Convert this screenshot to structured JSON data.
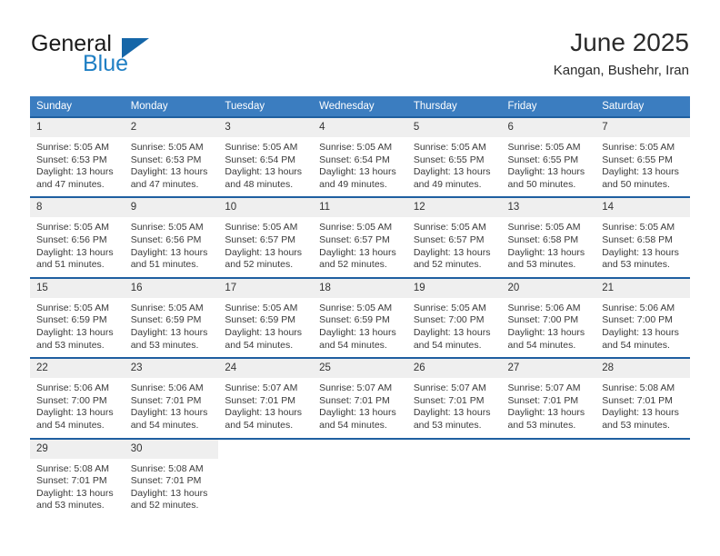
{
  "brand": {
    "name_part1": "General",
    "name_part2": "Blue",
    "accent_color": "#1f7fc4",
    "triangle_color": "#1566a8"
  },
  "header": {
    "title": "June 2025",
    "subtitle": "Kangan, Bushehr, Iran"
  },
  "calendar": {
    "header_bg": "#3b7dc0",
    "weekday_headers": [
      "Sunday",
      "Monday",
      "Tuesday",
      "Wednesday",
      "Thursday",
      "Friday",
      "Saturday"
    ],
    "weeks": [
      [
        {
          "day": "1",
          "sunrise": "Sunrise: 5:05 AM",
          "sunset": "Sunset: 6:53 PM",
          "daylight_line1": "Daylight: 13 hours",
          "daylight_line2": "and 47 minutes."
        },
        {
          "day": "2",
          "sunrise": "Sunrise: 5:05 AM",
          "sunset": "Sunset: 6:53 PM",
          "daylight_line1": "Daylight: 13 hours",
          "daylight_line2": "and 47 minutes."
        },
        {
          "day": "3",
          "sunrise": "Sunrise: 5:05 AM",
          "sunset": "Sunset: 6:54 PM",
          "daylight_line1": "Daylight: 13 hours",
          "daylight_line2": "and 48 minutes."
        },
        {
          "day": "4",
          "sunrise": "Sunrise: 5:05 AM",
          "sunset": "Sunset: 6:54 PM",
          "daylight_line1": "Daylight: 13 hours",
          "daylight_line2": "and 49 minutes."
        },
        {
          "day": "5",
          "sunrise": "Sunrise: 5:05 AM",
          "sunset": "Sunset: 6:55 PM",
          "daylight_line1": "Daylight: 13 hours",
          "daylight_line2": "and 49 minutes."
        },
        {
          "day": "6",
          "sunrise": "Sunrise: 5:05 AM",
          "sunset": "Sunset: 6:55 PM",
          "daylight_line1": "Daylight: 13 hours",
          "daylight_line2": "and 50 minutes."
        },
        {
          "day": "7",
          "sunrise": "Sunrise: 5:05 AM",
          "sunset": "Sunset: 6:55 PM",
          "daylight_line1": "Daylight: 13 hours",
          "daylight_line2": "and 50 minutes."
        }
      ],
      [
        {
          "day": "8",
          "sunrise": "Sunrise: 5:05 AM",
          "sunset": "Sunset: 6:56 PM",
          "daylight_line1": "Daylight: 13 hours",
          "daylight_line2": "and 51 minutes."
        },
        {
          "day": "9",
          "sunrise": "Sunrise: 5:05 AM",
          "sunset": "Sunset: 6:56 PM",
          "daylight_line1": "Daylight: 13 hours",
          "daylight_line2": "and 51 minutes."
        },
        {
          "day": "10",
          "sunrise": "Sunrise: 5:05 AM",
          "sunset": "Sunset: 6:57 PM",
          "daylight_line1": "Daylight: 13 hours",
          "daylight_line2": "and 52 minutes."
        },
        {
          "day": "11",
          "sunrise": "Sunrise: 5:05 AM",
          "sunset": "Sunset: 6:57 PM",
          "daylight_line1": "Daylight: 13 hours",
          "daylight_line2": "and 52 minutes."
        },
        {
          "day": "12",
          "sunrise": "Sunrise: 5:05 AM",
          "sunset": "Sunset: 6:57 PM",
          "daylight_line1": "Daylight: 13 hours",
          "daylight_line2": "and 52 minutes."
        },
        {
          "day": "13",
          "sunrise": "Sunrise: 5:05 AM",
          "sunset": "Sunset: 6:58 PM",
          "daylight_line1": "Daylight: 13 hours",
          "daylight_line2": "and 53 minutes."
        },
        {
          "day": "14",
          "sunrise": "Sunrise: 5:05 AM",
          "sunset": "Sunset: 6:58 PM",
          "daylight_line1": "Daylight: 13 hours",
          "daylight_line2": "and 53 minutes."
        }
      ],
      [
        {
          "day": "15",
          "sunrise": "Sunrise: 5:05 AM",
          "sunset": "Sunset: 6:59 PM",
          "daylight_line1": "Daylight: 13 hours",
          "daylight_line2": "and 53 minutes."
        },
        {
          "day": "16",
          "sunrise": "Sunrise: 5:05 AM",
          "sunset": "Sunset: 6:59 PM",
          "daylight_line1": "Daylight: 13 hours",
          "daylight_line2": "and 53 minutes."
        },
        {
          "day": "17",
          "sunrise": "Sunrise: 5:05 AM",
          "sunset": "Sunset: 6:59 PM",
          "daylight_line1": "Daylight: 13 hours",
          "daylight_line2": "and 54 minutes."
        },
        {
          "day": "18",
          "sunrise": "Sunrise: 5:05 AM",
          "sunset": "Sunset: 6:59 PM",
          "daylight_line1": "Daylight: 13 hours",
          "daylight_line2": "and 54 minutes."
        },
        {
          "day": "19",
          "sunrise": "Sunrise: 5:05 AM",
          "sunset": "Sunset: 7:00 PM",
          "daylight_line1": "Daylight: 13 hours",
          "daylight_line2": "and 54 minutes."
        },
        {
          "day": "20",
          "sunrise": "Sunrise: 5:06 AM",
          "sunset": "Sunset: 7:00 PM",
          "daylight_line1": "Daylight: 13 hours",
          "daylight_line2": "and 54 minutes."
        },
        {
          "day": "21",
          "sunrise": "Sunrise: 5:06 AM",
          "sunset": "Sunset: 7:00 PM",
          "daylight_line1": "Daylight: 13 hours",
          "daylight_line2": "and 54 minutes."
        }
      ],
      [
        {
          "day": "22",
          "sunrise": "Sunrise: 5:06 AM",
          "sunset": "Sunset: 7:00 PM",
          "daylight_line1": "Daylight: 13 hours",
          "daylight_line2": "and 54 minutes."
        },
        {
          "day": "23",
          "sunrise": "Sunrise: 5:06 AM",
          "sunset": "Sunset: 7:01 PM",
          "daylight_line1": "Daylight: 13 hours",
          "daylight_line2": "and 54 minutes."
        },
        {
          "day": "24",
          "sunrise": "Sunrise: 5:07 AM",
          "sunset": "Sunset: 7:01 PM",
          "daylight_line1": "Daylight: 13 hours",
          "daylight_line2": "and 54 minutes."
        },
        {
          "day": "25",
          "sunrise": "Sunrise: 5:07 AM",
          "sunset": "Sunset: 7:01 PM",
          "daylight_line1": "Daylight: 13 hours",
          "daylight_line2": "and 54 minutes."
        },
        {
          "day": "26",
          "sunrise": "Sunrise: 5:07 AM",
          "sunset": "Sunset: 7:01 PM",
          "daylight_line1": "Daylight: 13 hours",
          "daylight_line2": "and 53 minutes."
        },
        {
          "day": "27",
          "sunrise": "Sunrise: 5:07 AM",
          "sunset": "Sunset: 7:01 PM",
          "daylight_line1": "Daylight: 13 hours",
          "daylight_line2": "and 53 minutes."
        },
        {
          "day": "28",
          "sunrise": "Sunrise: 5:08 AM",
          "sunset": "Sunset: 7:01 PM",
          "daylight_line1": "Daylight: 13 hours",
          "daylight_line2": "and 53 minutes."
        }
      ],
      [
        {
          "day": "29",
          "sunrise": "Sunrise: 5:08 AM",
          "sunset": "Sunset: 7:01 PM",
          "daylight_line1": "Daylight: 13 hours",
          "daylight_line2": "and 53 minutes."
        },
        {
          "day": "30",
          "sunrise": "Sunrise: 5:08 AM",
          "sunset": "Sunset: 7:01 PM",
          "daylight_line1": "Daylight: 13 hours",
          "daylight_line2": "and 52 minutes."
        },
        {
          "day": "",
          "sunrise": "",
          "sunset": "",
          "daylight_line1": "",
          "daylight_line2": ""
        },
        {
          "day": "",
          "sunrise": "",
          "sunset": "",
          "daylight_line1": "",
          "daylight_line2": ""
        },
        {
          "day": "",
          "sunrise": "",
          "sunset": "",
          "daylight_line1": "",
          "daylight_line2": ""
        },
        {
          "day": "",
          "sunrise": "",
          "sunset": "",
          "daylight_line1": "",
          "daylight_line2": ""
        },
        {
          "day": "",
          "sunrise": "",
          "sunset": "",
          "daylight_line1": "",
          "daylight_line2": ""
        }
      ]
    ]
  }
}
